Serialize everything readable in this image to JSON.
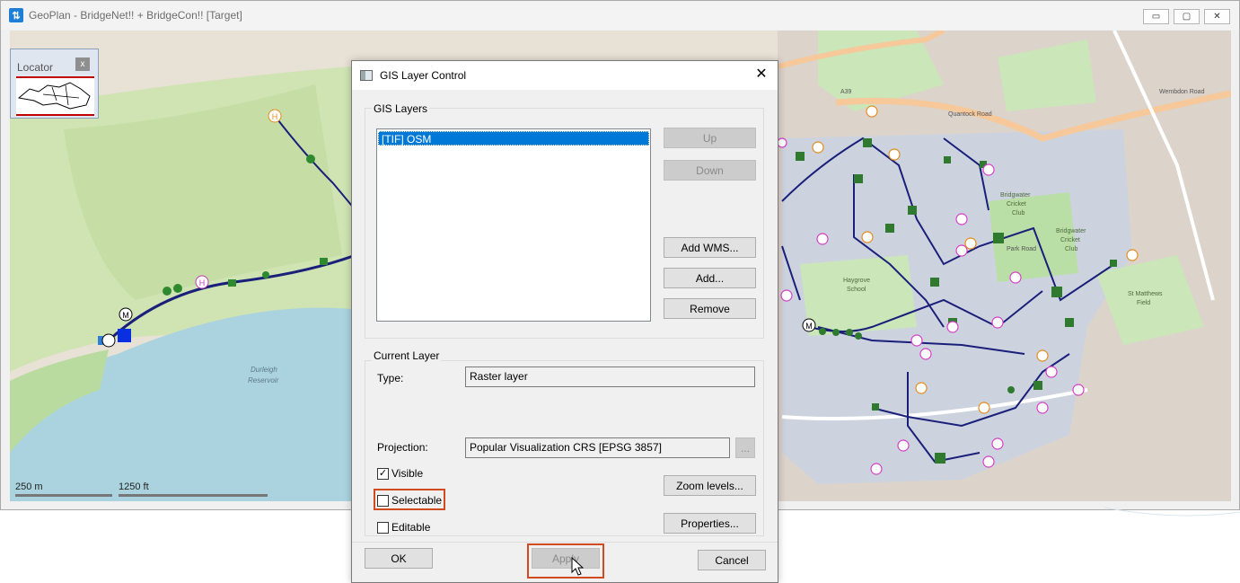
{
  "window": {
    "title": "GeoPlan - BridgeNet!! + BridgeCon!! [Target]",
    "controls": {
      "minimize": "▭",
      "restore": "▢",
      "close": "✕"
    }
  },
  "locator": {
    "title": "Locator",
    "close": "x"
  },
  "map": {
    "scale_metric": "250 m",
    "scale_imperial": "1250 ft",
    "labels": {
      "reservoir": "Durleigh\nReservoir",
      "school": "Haygrove\nSchool",
      "cricket1": "Bridgwater\nCricket\nClub",
      "cricket2": "Bridgwater\nCricket\nClub",
      "field": "St Matthews\nField",
      "park_road": "Park Road",
      "quantock": "Quantock Road",
      "a39": "A39",
      "wembdon": "Wembdon Road"
    },
    "node_letters": {
      "manhole": "M",
      "hydrant": "H"
    },
    "colors": {
      "pipe": "#1a1f7a",
      "node_green": "#1f7a1f",
      "hydrant_pink": "#d63fc6",
      "hydrant_orange": "#e38b1c",
      "water": "#aad3df",
      "park": "#c8e6b0",
      "residential": "#d9d0c9",
      "network_area": "#c9d0dd"
    }
  },
  "dialog": {
    "title": "GIS Layer Control",
    "close": "✕",
    "gis_layers": {
      "label": "GIS Layers",
      "items": [
        "[TIF] OSM"
      ],
      "buttons": {
        "up": "Up",
        "down": "Down",
        "add_wms": "Add WMS...",
        "add": "Add...",
        "remove": "Remove"
      }
    },
    "current_layer": {
      "label": "Current Layer",
      "type_label": "Type:",
      "type_value": "Raster layer",
      "projection_label": "Projection:",
      "projection_value": "Popular Visualization CRS [EPSG 3857]",
      "projection_browse": "...",
      "visible_label": "Visible",
      "visible_checked": true,
      "selectable_label": "Selectable",
      "selectable_checked": false,
      "editable_label": "Editable",
      "editable_checked": false,
      "zoom_levels": "Zoom levels...",
      "properties": "Properties..."
    },
    "footer": {
      "ok": "OK",
      "apply": "Apply",
      "cancel": "Cancel"
    }
  }
}
